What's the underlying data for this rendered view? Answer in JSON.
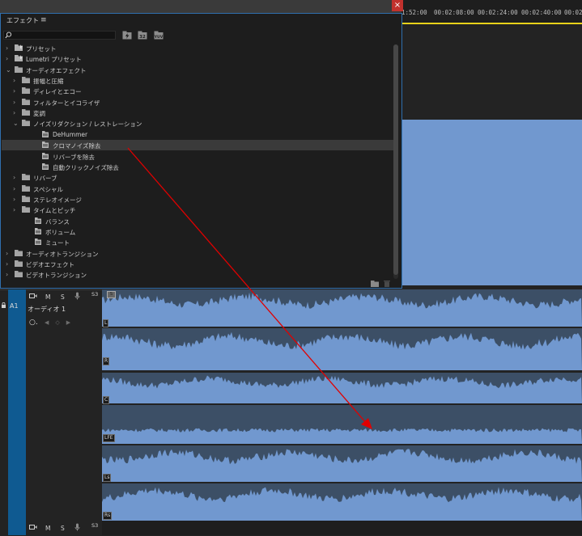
{
  "effects_panel": {
    "title": "エフェクト",
    "menu_icon": "hamburger-icon",
    "search": {
      "value": "",
      "placeholder": ""
    },
    "toolbar_icons": [
      "accelerated-effects-icon",
      "32bit-color-icon",
      "yuv-effects-icon"
    ],
    "tree": [
      {
        "label": "プリセット",
        "depth": 0,
        "expanded": false,
        "kind": "preset-folder"
      },
      {
        "label": "Lumetri プリセット",
        "depth": 0,
        "expanded": false,
        "kind": "preset-folder"
      },
      {
        "label": "オーディオエフェクト",
        "depth": 0,
        "expanded": true,
        "kind": "folder"
      },
      {
        "label": "振幅と圧縮",
        "depth": 1,
        "expanded": false,
        "kind": "folder"
      },
      {
        "label": "ディレイとエコー",
        "depth": 1,
        "expanded": false,
        "kind": "folder"
      },
      {
        "label": "フィルターとイコライザ",
        "depth": 1,
        "expanded": false,
        "kind": "folder"
      },
      {
        "label": "変調",
        "depth": 1,
        "expanded": false,
        "kind": "folder"
      },
      {
        "label": "ノイズリダクション / レストレーション",
        "depth": 1,
        "expanded": true,
        "kind": "folder"
      },
      {
        "label": "DeHummer",
        "depth": 2,
        "kind": "effect"
      },
      {
        "label": "クロマノイズ除去",
        "depth": 2,
        "kind": "effect",
        "selected": true
      },
      {
        "label": "リバーブを除去",
        "depth": 2,
        "kind": "effect"
      },
      {
        "label": "自動クリックノイズ除去",
        "depth": 2,
        "kind": "effect"
      },
      {
        "label": "リバーブ",
        "depth": 1,
        "expanded": false,
        "kind": "folder"
      },
      {
        "label": "スペシャル",
        "depth": 1,
        "expanded": false,
        "kind": "folder"
      },
      {
        "label": "ステレオイメージ",
        "depth": 1,
        "expanded": false,
        "kind": "folder"
      },
      {
        "label": "タイムとピッチ",
        "depth": 1,
        "expanded": false,
        "kind": "folder"
      },
      {
        "label": "バランス",
        "depth": 1,
        "kind": "effect"
      },
      {
        "label": "ボリューム",
        "depth": 1,
        "kind": "effect"
      },
      {
        "label": "ミュート",
        "depth": 1,
        "kind": "effect"
      },
      {
        "label": "オーディオトランジション",
        "depth": 0,
        "expanded": false,
        "kind": "folder"
      },
      {
        "label": "ビデオエフェクト",
        "depth": 0,
        "expanded": false,
        "kind": "folder"
      },
      {
        "label": "ビデオトランジション",
        "depth": 0,
        "expanded": false,
        "kind": "folder"
      }
    ]
  },
  "timeline": {
    "timecodes": [
      "1:52:00",
      "00:02:08:00",
      "00:02:24:00",
      "00:02:40:00",
      "00:02:"
    ],
    "track": {
      "id": "A1",
      "name": "オーディオ 1",
      "buttons": {
        "mute": "M",
        "solo": "S"
      },
      "channel_format": "S3",
      "keyframe_glyph": "○.",
      "nav_glyphs": "◀◇▶"
    },
    "channels": [
      "L",
      "R",
      "C",
      "LFE",
      "Ls",
      "Rs"
    ],
    "colors": {
      "waveform": "#7198cf",
      "lane_bg": "#3c4f66",
      "playhead_bar": "#e8d21a",
      "track_selected": "#0f5a91",
      "annotation_arrow": "#e00000"
    }
  }
}
